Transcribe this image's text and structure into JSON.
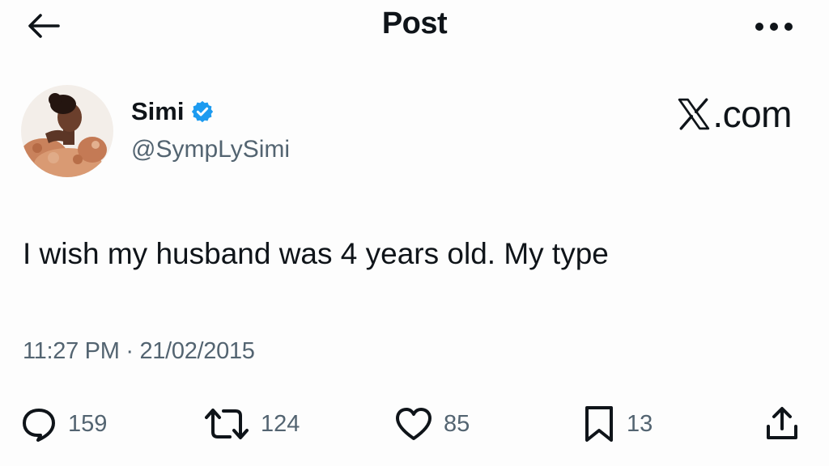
{
  "header": {
    "title": "Post"
  },
  "author": {
    "name": "Simi",
    "handle": "@SympLySimi",
    "verified": true
  },
  "brand": {
    "text": ".com"
  },
  "post": {
    "text": "I wish my husband was 4 years old. My type",
    "time": "11:27 PM",
    "separator": "·",
    "date": "21/02/2015"
  },
  "actions": {
    "replies": "159",
    "reposts": "124",
    "likes": "85",
    "bookmarks": "13"
  },
  "colors": {
    "text": "#0f1419",
    "secondary": "#536471",
    "verified": "#1d9bf0"
  },
  "icons": {
    "back": "arrow-left-icon",
    "more": "more-dots-icon",
    "verified": "verified-badge-icon",
    "brand": "x-logo-icon",
    "reply": "reply-icon",
    "repost": "repost-icon",
    "like": "heart-icon",
    "bookmark": "bookmark-icon",
    "share": "share-icon"
  }
}
